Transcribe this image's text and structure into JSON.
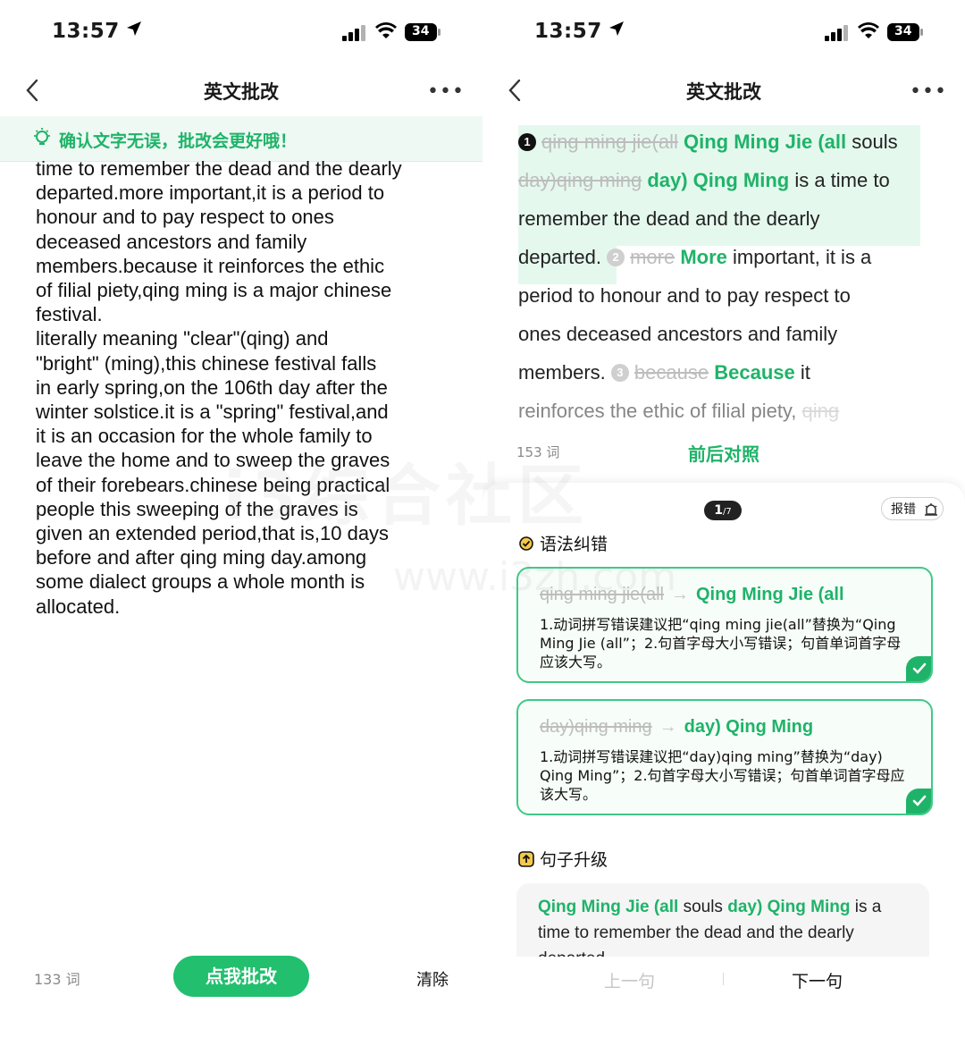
{
  "status_bar": {
    "time": "13:57",
    "battery": "34"
  },
  "left": {
    "nav_title": "英文批改",
    "tip": "确认文字无误，批改会更好哦！",
    "essay_lines": [
      "time to remember the dead and the dearly",
      "departed.more important,it is a period to",
      "honour and to pay respect to ones",
      "deceased ancestors and family",
      "members.because it reinforces the ethic",
      "of filial piety,qing ming is a major chinese",
      "festival.",
      "literally meaning \"clear\"(qing) and",
      "\"bright\" (ming),this chinese festival falls",
      "in early spring,on the 106th day after the",
      "winter solstice.it is a \"spring\" festival,and",
      "it is an occasion for the whole family to",
      "leave the home and to sweep the graves",
      "of their forebears.chinese being practical",
      "people this sweeping of the graves is",
      "given an extended period,that is,10 days",
      "before and after qing ming day.among",
      "some dialect groups a whole month is",
      "allocated."
    ],
    "word_count": "133 词",
    "submit_label": "点我批改",
    "clear_label": "清除"
  },
  "right": {
    "nav_title": "英文批改",
    "annotated": {
      "l1_del": "qing ming jie(all",
      "l1_ins": "Qing Ming Jie (all",
      "l1_rest": " souls",
      "l2_del": "day)qing ming",
      "l2_ins": "day) Qing Ming",
      "l2_rest": " is a time to",
      "l3": "remember the dead and the dearly",
      "l4_a": "departed.",
      "l4_del": "more",
      "l4_ins": "More",
      "l4_rest": " important, it is a",
      "l5": "period to honour and to pay respect to",
      "l6": "ones deceased ancestors and family",
      "l7_a": "members.",
      "l7_del": "because",
      "l7_ins": "Because",
      "l7_rest": " it",
      "l8_a": "reinforces the ethic of filial piety, ",
      "l8_fade": "qing",
      "n1": "1",
      "n2": "2",
      "n3": "3"
    },
    "word_count": "153 词",
    "compare_label": "前后对照",
    "pager_current": "1",
    "pager_total": "/7",
    "report_label": "报错",
    "grammar_title": "语法纠错",
    "cards": [
      {
        "from": "qing ming jie(all",
        "to": "Qing Ming Jie (all",
        "desc": "1.动词拼写错误建议把“qing ming jie(all”替换为“Qing Ming Jie (all”；2.句首字母大小写错误；句首单词首字母应该大写。"
      },
      {
        "from": "day)qing ming",
        "to": "day) Qing Ming",
        "desc": "1.动词拼写错误建议把“day)qing ming”替换为“day) Qing Ming”；2.句首字母大小写错误；句首单词首字母应该大写。"
      }
    ],
    "upgrade_title": "句子升级",
    "upgrade": {
      "g1": "Qing Ming Jie (all",
      "t1": " souls ",
      "g2": "day) Qing Ming",
      "t2": " is a time to remember the dead and the dearly departed."
    },
    "prev_label": "上一句",
    "next_label": "下一句"
  },
  "watermark": {
    "text": "i3综合社区",
    "url": "www.i3zh.com"
  },
  "colors": {
    "accent": "#1fb369",
    "button": "#22bf6e",
    "tip_bg": "#eef9f3"
  }
}
